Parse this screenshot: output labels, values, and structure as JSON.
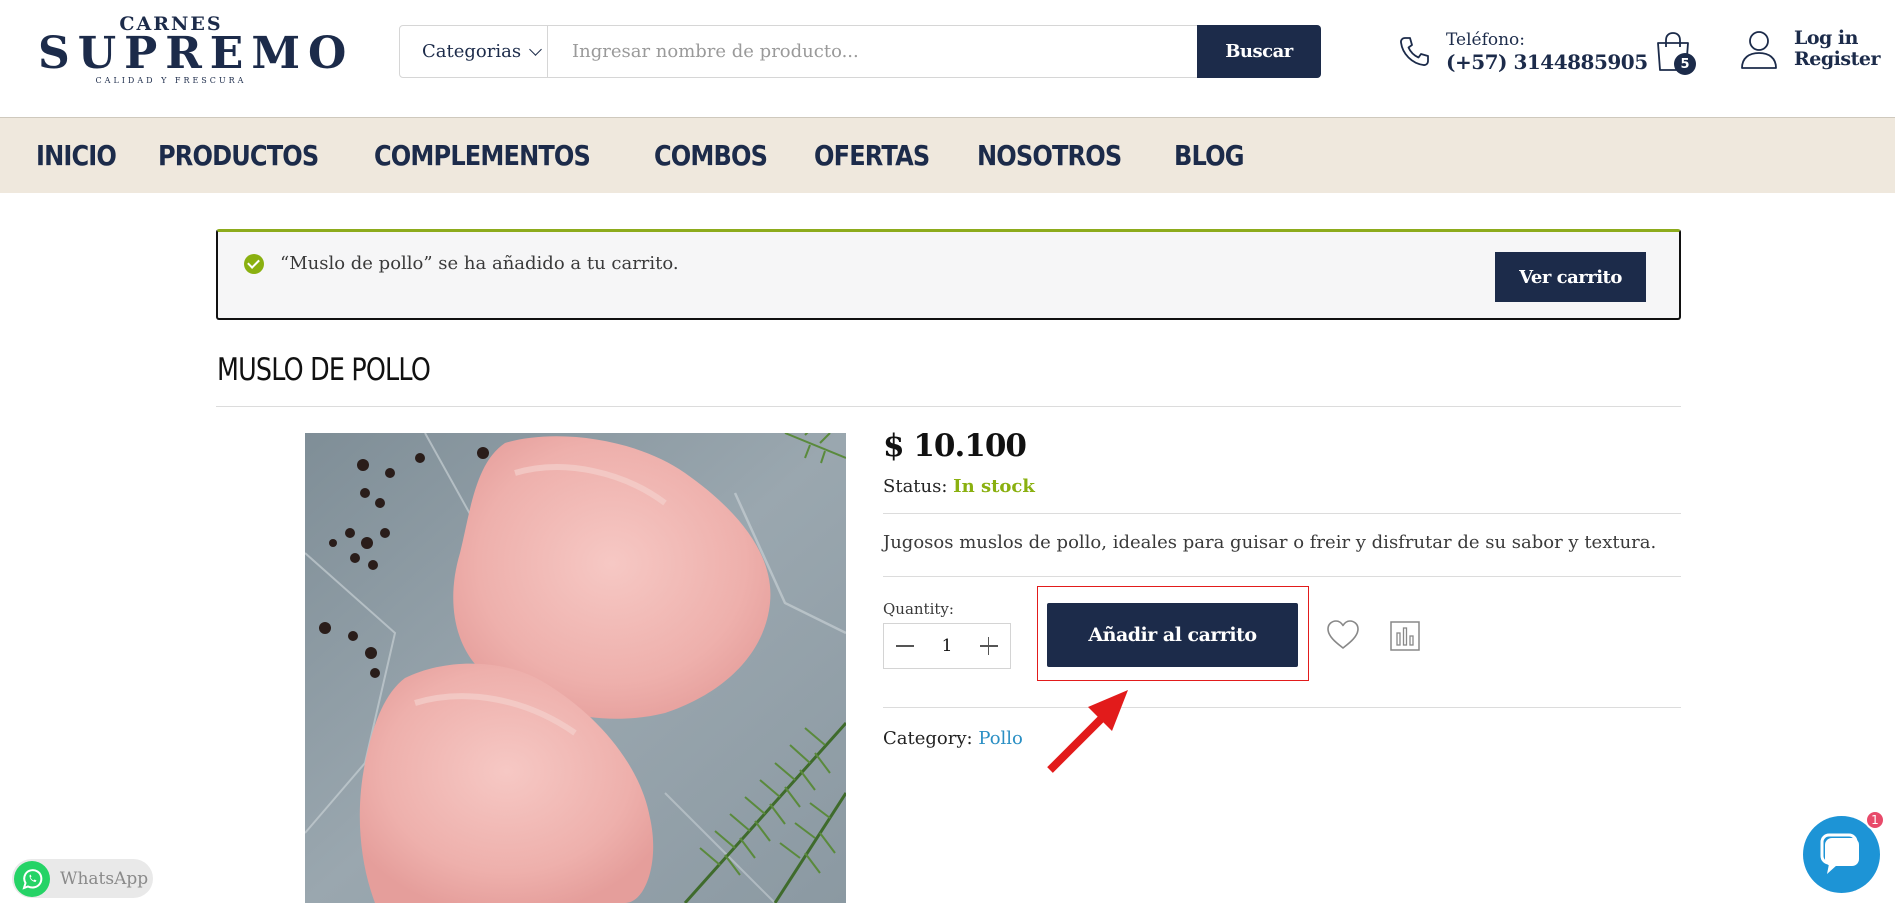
{
  "header": {
    "logo": {
      "top": "CARNES",
      "main": "SUPREMO",
      "tagline": "CALIDAD Y FRESCURA"
    },
    "search": {
      "category_label": "Categorias",
      "placeholder": "Ingresar nombre de producto...",
      "button_label": "Buscar"
    },
    "phone": {
      "label": "Teléfono:",
      "number": "(+57) 3144885905"
    },
    "cart_count": "5",
    "account": {
      "login": "Log in",
      "register": "Register"
    }
  },
  "nav": {
    "items": [
      "INICIO",
      "PRODUCTOS",
      "COMPLEMENTOS",
      "COMBOS",
      "OFERTAS",
      "NOSOTROS",
      "BLOG"
    ]
  },
  "notice": {
    "message": "“Muslo de pollo” se ha añadido a tu carrito.",
    "button_label": "Ver carrito"
  },
  "product": {
    "title": "MUSLO DE POLLO",
    "price": "$ 10.100",
    "status_label": "Status:",
    "status_value": "In stock",
    "description": "Jugosos muslos de pollo, ideales para guisar o freir y disfrutar de su sabor y textura.",
    "quantity_label": "Quantity:",
    "quantity_value": "1",
    "add_button_label": "Añadir al carrito",
    "category_label": "Category:",
    "category_value": "Pollo"
  },
  "whatsapp": {
    "label": "WhatsApp"
  },
  "chat": {
    "badge": "1"
  },
  "colors": {
    "navy": "#1c2b4a",
    "nav_bg": "#efe8dd",
    "stock_green": "#8ab010",
    "link_blue": "#2a8fc4",
    "highlight_red": "#e21b1b",
    "chat_blue": "#1d94d6"
  }
}
